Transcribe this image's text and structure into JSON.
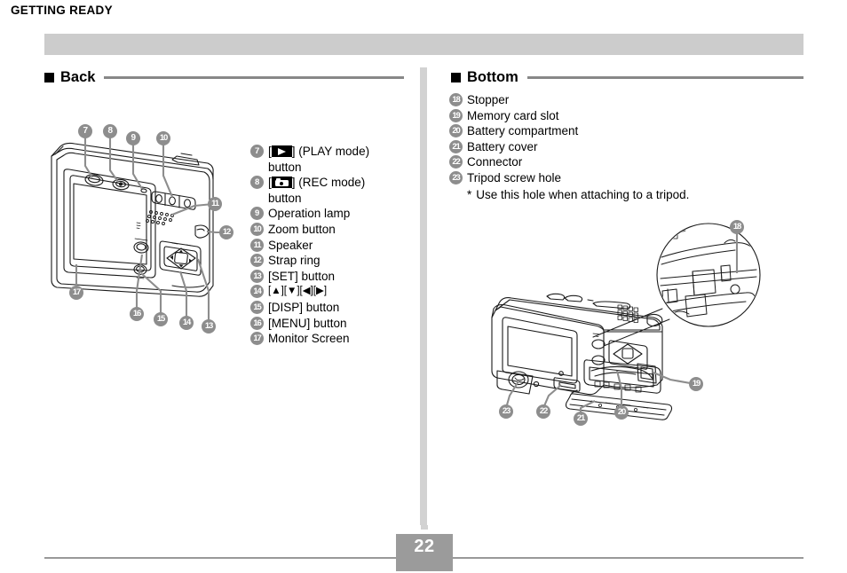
{
  "header": {
    "running_title": "GETTING READY"
  },
  "sections": {
    "back": {
      "title": "Back",
      "items": [
        {
          "num": "7",
          "text": "(PLAY mode)",
          "cont": "button",
          "icon": "play-chip",
          "bracketed": true
        },
        {
          "num": "8",
          "text": "(REC mode)",
          "cont": "button",
          "icon": "camera-chip",
          "bracketed": true
        },
        {
          "num": "9",
          "text": "Operation lamp"
        },
        {
          "num": "10",
          "text": "Zoom button"
        },
        {
          "num": "11",
          "text": "Speaker"
        },
        {
          "num": "12",
          "text": "Strap ring"
        },
        {
          "num": "13",
          "text": "[SET] button"
        },
        {
          "num": "14",
          "text": "[▲][▼][◀][▶]"
        },
        {
          "num": "15",
          "text": "[DISP] button"
        },
        {
          "num": "16",
          "text": "[MENU] button"
        },
        {
          "num": "17",
          "text": "Monitor Screen"
        }
      ],
      "callouts": [
        "7",
        "8",
        "9",
        "10",
        "11",
        "12",
        "13",
        "14",
        "15",
        "16",
        "17"
      ]
    },
    "bottom": {
      "title": "Bottom",
      "items": [
        {
          "num": "18",
          "text": "Stopper"
        },
        {
          "num": "19",
          "text": "Memory card slot"
        },
        {
          "num": "20",
          "text": "Battery compartment"
        },
        {
          "num": "21",
          "text": "Battery cover"
        },
        {
          "num": "22",
          "text": "Connector"
        },
        {
          "num": "23",
          "text": "Tripod screw hole"
        }
      ],
      "note": {
        "marker": "*",
        "text": "Use this hole when attaching to a tripod."
      },
      "callouts": [
        "18",
        "19",
        "20",
        "21",
        "22",
        "23"
      ]
    }
  },
  "footer": {
    "page_number": "22"
  },
  "colors": {
    "header_bar": "#cccccc",
    "rule": "#888888",
    "badge": "#8d8d8d",
    "divider": "#d2d2d2",
    "page_box": "#9b9b9b",
    "line_art": "#1a1a1a"
  }
}
